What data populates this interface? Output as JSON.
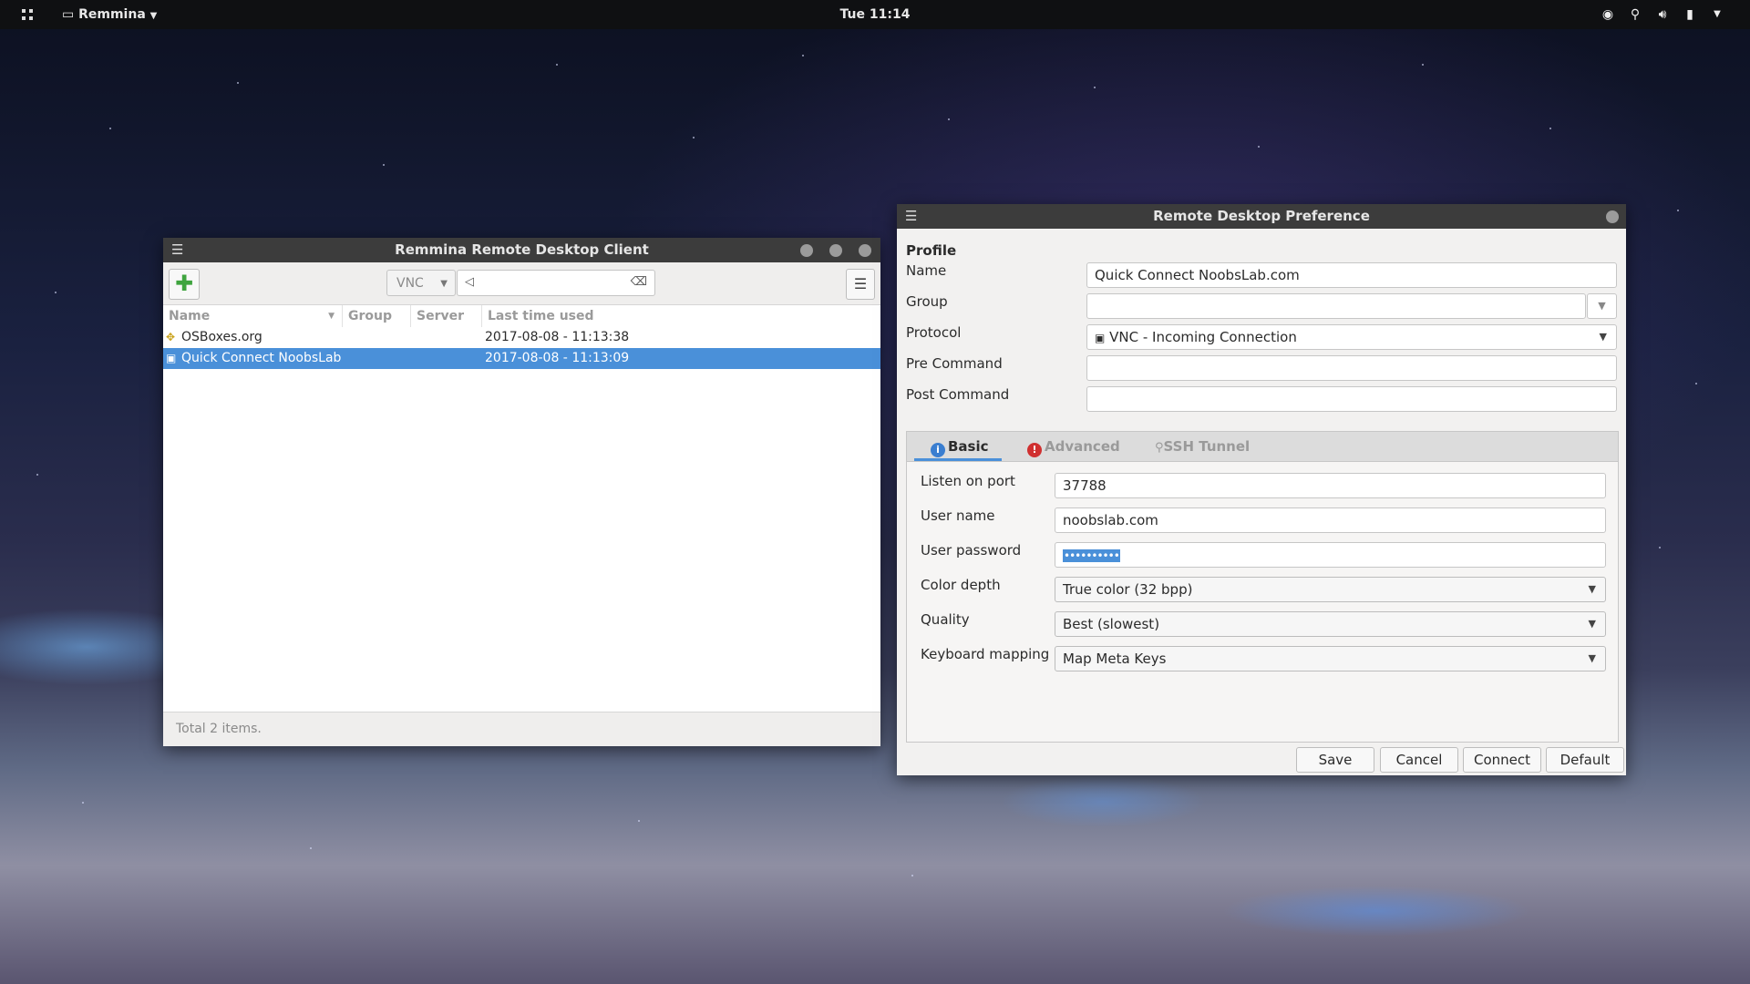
{
  "topbar": {
    "app_name": "Remmina",
    "clock": "Tue 11:14",
    "tray_icons": [
      "settings-icon",
      "network-icon",
      "volume-icon",
      "battery-icon",
      "power-menu-icon"
    ]
  },
  "main_window": {
    "title": "Remmina Remote Desktop Client",
    "toolbar": {
      "protocol": "VNC",
      "quick_connect_value": ""
    },
    "columns": [
      "Name",
      "Group",
      "Server",
      "Last time used"
    ],
    "rows": [
      {
        "name": "OSBoxes.org",
        "group": "",
        "server": "",
        "last_used": "2017-08-08 - 11:13:38",
        "selected": false
      },
      {
        "name": "Quick Connect NoobsLab",
        "group": "",
        "server": "",
        "last_used": "2017-08-08 - 11:13:09",
        "selected": true
      }
    ],
    "status": "Total 2 items."
  },
  "pref_window": {
    "title": "Remote Desktop Preference",
    "profile_heading": "Profile",
    "labels": {
      "name": "Name",
      "group": "Group",
      "protocol": "Protocol",
      "pre_command": "Pre Command",
      "post_command": "Post Command"
    },
    "values": {
      "name": "Quick Connect NoobsLab.com",
      "group": "",
      "protocol": "VNC - Incoming Connection",
      "pre_command": "",
      "post_command": ""
    },
    "tabs": [
      "Basic",
      "Advanced",
      "SSH Tunnel"
    ],
    "basic": {
      "labels": {
        "port": "Listen on port",
        "user": "User name",
        "password": "User password",
        "color": "Color depth",
        "quality": "Quality",
        "keymap": "Keyboard mapping"
      },
      "values": {
        "port": "37788",
        "user": "noobslab.com",
        "password": "••••••••••",
        "color": "True color (32 bpp)",
        "quality": "Best (slowest)",
        "keymap": "Map Meta Keys"
      }
    },
    "buttons": {
      "save": "Save",
      "cancel": "Cancel",
      "connect": "Connect",
      "default": "Default"
    }
  }
}
